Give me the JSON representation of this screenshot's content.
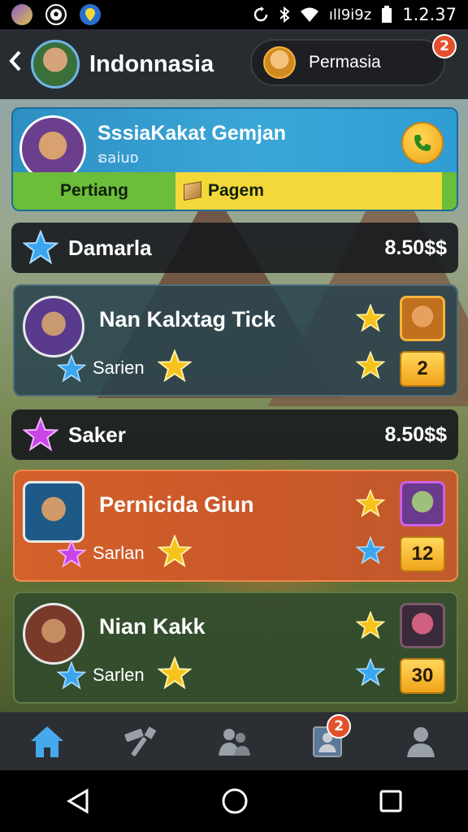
{
  "status_bar": {
    "signal_text": "ıll9i9z",
    "time": "1.2.37",
    "icons": [
      "app-icon",
      "soccer-icon",
      "map-pin-icon",
      "sync-icon",
      "bluetooth-icon",
      "wifi-icon",
      "battery-icon"
    ]
  },
  "header": {
    "title": "Indonnasia",
    "pill_label": "Permasia",
    "pill_badge": "2"
  },
  "profile": {
    "name": "SssiaKakat Gemjan",
    "subtitle": "ຣaiuᴅ",
    "bar_left": "Pertiang",
    "bar_right": "Pagem"
  },
  "sections": [
    {
      "title": "Damarla",
      "value": "8.50$$",
      "star_color": "#3aa6f0"
    },
    {
      "title": "Saker",
      "value": "8.50$$",
      "star_color": "#c846e8"
    }
  ],
  "players": [
    {
      "name": "Nan Kalxtag Tick",
      "sub": "Sarien",
      "count": "2",
      "sub_star_color": "#3aa6f0",
      "second_star_color": "#f6c21c"
    },
    {
      "name": "Pernicida Giun",
      "sub": "Sarlan",
      "count": "12",
      "sub_star_color": "#c846e8",
      "second_star_color": "#3aa6f0"
    },
    {
      "name": "Nian Kakk",
      "sub": "Sarlen",
      "count": "30",
      "sub_star_color": "#3aa6f0",
      "second_star_color": "#3aa6f0"
    }
  ],
  "bottom_nav": {
    "items": [
      "home-icon",
      "hammer-icon",
      "friends-icon",
      "profile-card-icon",
      "user-icon"
    ],
    "badge": "2",
    "active_color": "#46a9ee"
  },
  "colors": {
    "gold_star": "#f6c21c",
    "badge_red": "#e4502c",
    "header_bg": "#22262c"
  }
}
